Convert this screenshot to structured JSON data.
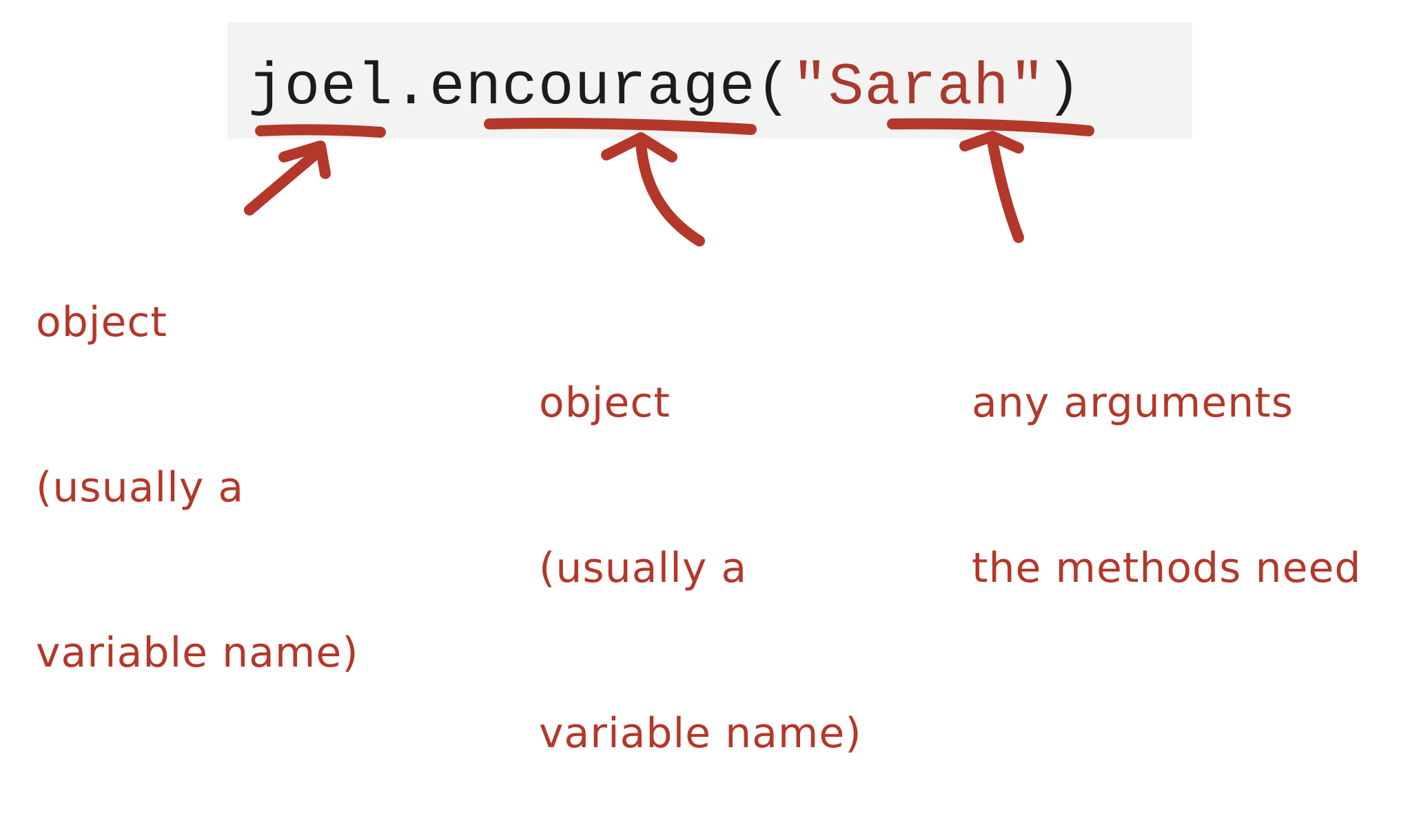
{
  "code": {
    "object": "joel",
    "dot": ".",
    "method": "encourage",
    "open_paren": "(",
    "string": "\"Sarah\"",
    "close_paren": ")"
  },
  "annotations": {
    "object_note": {
      "line1": "object",
      "line2": "(usually a",
      "line3": "variable name)"
    },
    "method_note": {
      "line1": "object",
      "line2": "(usually a",
      "line3": "variable name)"
    },
    "arguments_note": {
      "line1": "any arguments",
      "line2": "the methods need"
    }
  },
  "colors": {
    "annotation": "#b3382a",
    "code_background": "#f3f3f3",
    "code_text": "#1c1c1c",
    "string_literal": "#a83a2e"
  }
}
